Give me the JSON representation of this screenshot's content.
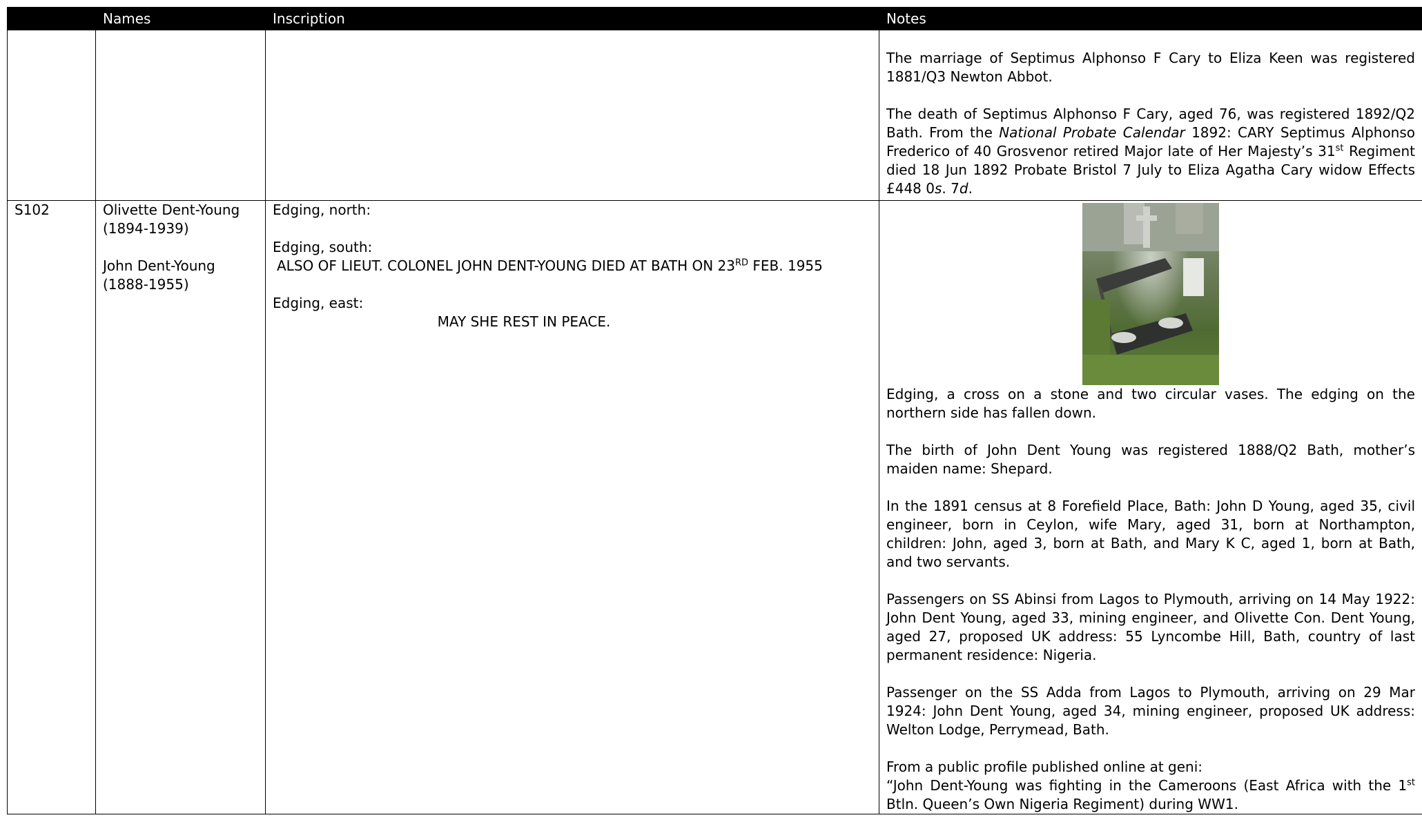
{
  "headers": {
    "col0": "",
    "names": "Names",
    "inscription": "Inscription",
    "notes": "Notes"
  },
  "row1": {
    "notes": {
      "p1": "The marriage of Septimus Alphonso F Cary to Eliza Keen was registered 1881/Q3 Newton Abbot.",
      "p2_a": "The death of Septimus Alphonso F Cary, aged 76, was registered 1892/Q2 Bath. From the ",
      "p2_italic": "National Probate Calendar",
      "p2_b": " 1892: CARY Septimus Alphonso Frederico of 40 Grosvenor retired Major late of Her Majesty’s 31",
      "p2_sup": "st",
      "p2_c": " Regiment died 18 Jun 1892 Probate Bristol 7 July to Eliza Agatha Cary widow Effects £448 0",
      "p2_s": "s",
      "p2_d": ". 7",
      "p2_dd": "d",
      "p2_e": "."
    }
  },
  "row2": {
    "id": "S102",
    "name1": "Olivette Dent-Young (1894-1939)",
    "name2": "John Dent-Young (1888-1955)",
    "inscription": {
      "north_label": "Edging, north:",
      "south_label": "Edging, south:",
      "south_text_a": "ALSO OF LIEUT. COLONEL JOHN DENT-YOUNG DIED AT BATH ON 23",
      "south_sup": "RD",
      "south_text_b": " FEB. 1955",
      "east_label": "Edging, east:",
      "east_text": "MAY SHE REST IN PEACE."
    },
    "notes": {
      "p1": "Edging, a cross on a stone and two circular vases. The edging on the northern side has fallen down.",
      "p2": "The birth of John Dent Young was registered 1888/Q2 Bath, mother’s maiden name: Shepard.",
      "p3": "In the 1891 census at 8 Forefield Place, Bath: John D Young, aged 35, civil engineer, born in Ceylon, wife Mary, aged 31, born at Northampton, children: John, aged 3, born at Bath, and Mary K C, aged 1, born at Bath, and two servants.",
      "p4": "Passengers on SS Abinsi from Lagos to Plymouth, arriving on 14 May 1922: John Dent Young, aged 33, mining engineer, and Olivette Con. Dent Young, aged 27, proposed UK address: 55 Lyncombe Hill, Bath, country of last permanent residence: Nigeria.",
      "p5": "Passenger on the SS Adda from Lagos to Plymouth, arriving on 29 Mar 1924: John Dent Young, aged 34, mining engineer, proposed UK address: Welton Lodge, Perrymead, Bath.",
      "p6_a": "From a public profile published online at geni:",
      "p6_b": "“John Dent-Young was fighting in the Cameroons (East Africa with the 1",
      "p6_sup": "st",
      "p6_c": " Btln. Queen’s Own Nigeria Regiment) during WW1."
    }
  }
}
